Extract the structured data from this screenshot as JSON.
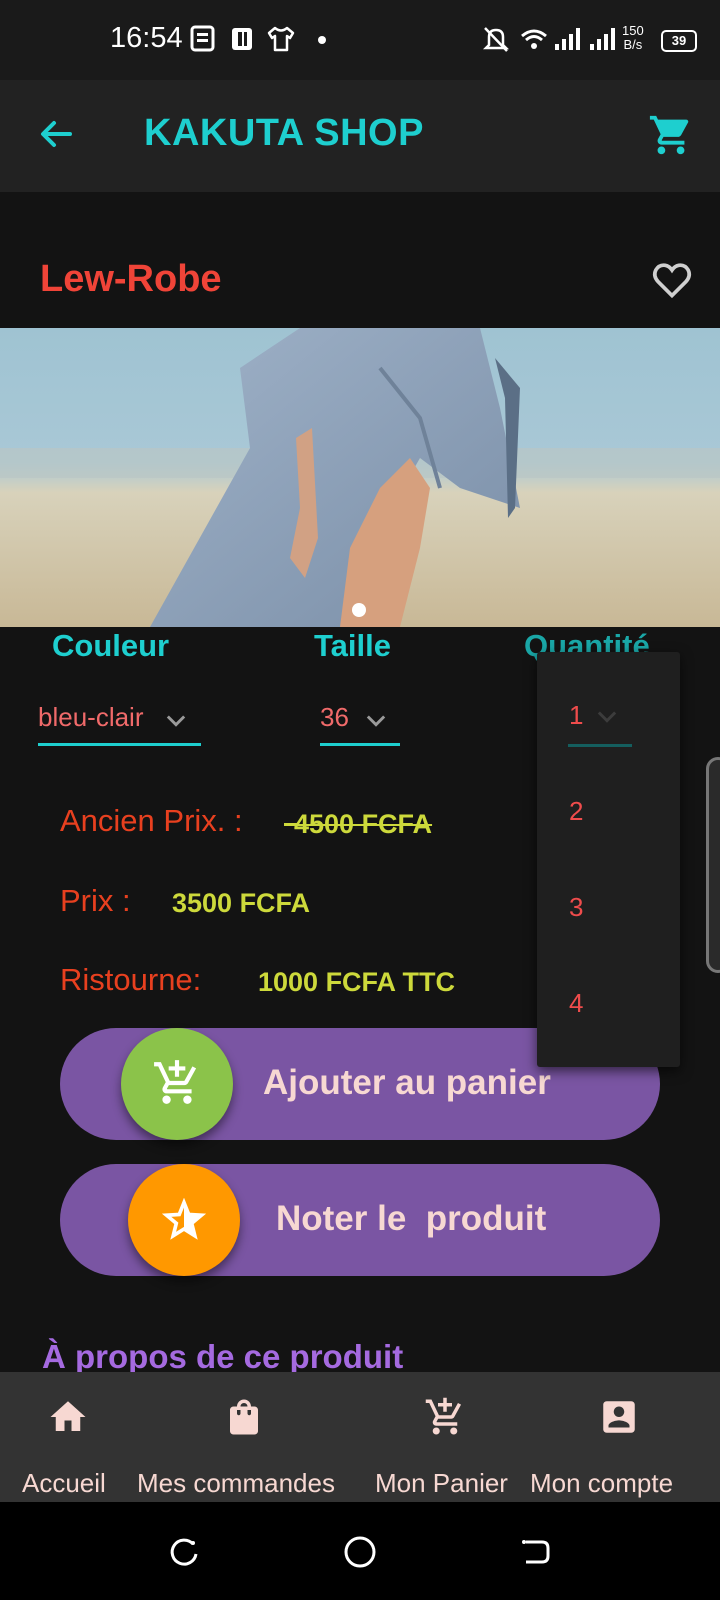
{
  "status_bar": {
    "time": "16:54",
    "net_speed_top": "150",
    "net_speed_bottom": "B/s",
    "battery": "39"
  },
  "app_bar": {
    "title": "KAKUTA SHOP"
  },
  "product": {
    "name": "Lew-Robe"
  },
  "carousel": {
    "pages": 1,
    "current": 1
  },
  "selectors": {
    "color": {
      "label": "Couleur",
      "value": "bleu-clair"
    },
    "size": {
      "label": "Taille",
      "value": "36"
    },
    "quantity": {
      "label": "Quantité",
      "value": "1"
    }
  },
  "quantity_dropdown": {
    "options": [
      "1",
      "2",
      "3",
      "4"
    ]
  },
  "pricing": {
    "old_price_label": "Ancien Prix. :",
    "old_price_value": "4500 FCFA",
    "price_label": "Prix :",
    "price_value": "3500 FCFA",
    "discount_label": "Ristourne:",
    "discount_value": "1000 FCFA TTC"
  },
  "actions": {
    "add_to_cart": "Ajouter au panier",
    "rate_product": "Noter le  produit"
  },
  "about": {
    "title": "À propos de ce produit"
  },
  "bottom_nav": {
    "items": [
      {
        "label": "Accueil",
        "icon": "home-icon"
      },
      {
        "label": "Mes commandes",
        "icon": "shopping-bag-icon"
      },
      {
        "label": "Mon Panier",
        "icon": "cart-icon"
      },
      {
        "label": "Mon compte",
        "icon": "account-icon"
      }
    ]
  },
  "colors": {
    "accent": "#1ecfcf",
    "title_red": "#f04438",
    "price_yellow": "#cdd93b",
    "button_purple": "#7a55a3",
    "add_green": "#8bc34a",
    "rate_orange": "#ff9800"
  }
}
